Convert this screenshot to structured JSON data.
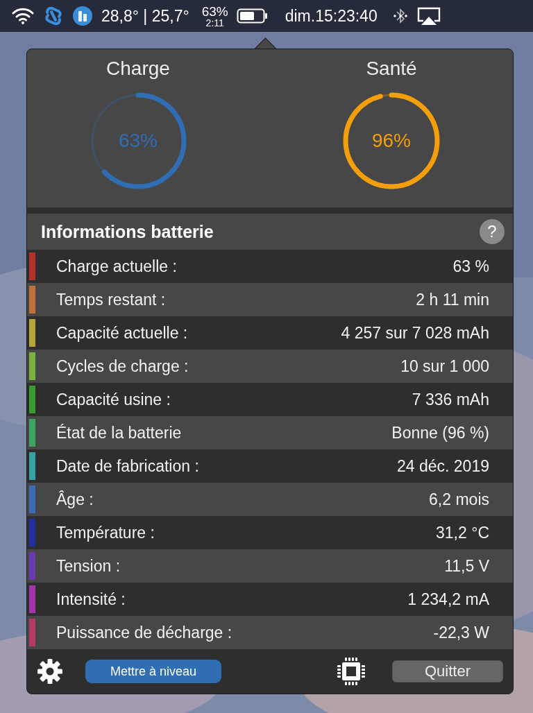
{
  "menu_bar": {
    "temperature": "28,8° | 25,7°",
    "battery_percent": "63%",
    "battery_time": "2:11",
    "clock": "dim.15:23:40"
  },
  "gauges": [
    {
      "title": "Charge",
      "value": "63%",
      "level": 0.63,
      "color": "#2f6db5"
    },
    {
      "title": "Santé",
      "value": "96%",
      "level": 0.96,
      "color": "#f59e0b"
    }
  ],
  "section": {
    "title": "Informations batterie",
    "help": "?"
  },
  "rows": [
    {
      "label": "Charge actuelle :",
      "value": "63 %",
      "color": "#b3302b"
    },
    {
      "label": "Temps restant :",
      "value": "2 h 11 min",
      "color": "#c0703a"
    },
    {
      "label": "Capacité actuelle :",
      "value": "4 257 sur 7 028 mAh",
      "color": "#b3a635"
    },
    {
      "label": "Cycles de charge :",
      "value": "10 sur 1 000",
      "color": "#78b13e"
    },
    {
      "label": "Capacité usine :",
      "value": "7 336 mAh",
      "color": "#3a9b32"
    },
    {
      "label": "État de la batterie",
      "value": "Bonne (96 %)",
      "color": "#3da464"
    },
    {
      "label": "Date de fabrication :",
      "value": "24 déc. 2019",
      "color": "#33a3a3"
    },
    {
      "label": "Âge :",
      "value": "6,2 mois",
      "color": "#3a6cb4"
    },
    {
      "label": "Température :",
      "value": "31,2 °C",
      "color": "#2230a3"
    },
    {
      "label": "Tension :",
      "value": "11,5 V",
      "color": "#6a3ab3"
    },
    {
      "label": "Intensité :",
      "value": "1 234,2 mA",
      "color": "#a534aa"
    },
    {
      "label": "Puissance de décharge :",
      "value": "-22,3 W",
      "color": "#b33a62"
    }
  ],
  "footer": {
    "upgrade_button": "Mettre à niveau",
    "quit_button": "Quitter"
  }
}
